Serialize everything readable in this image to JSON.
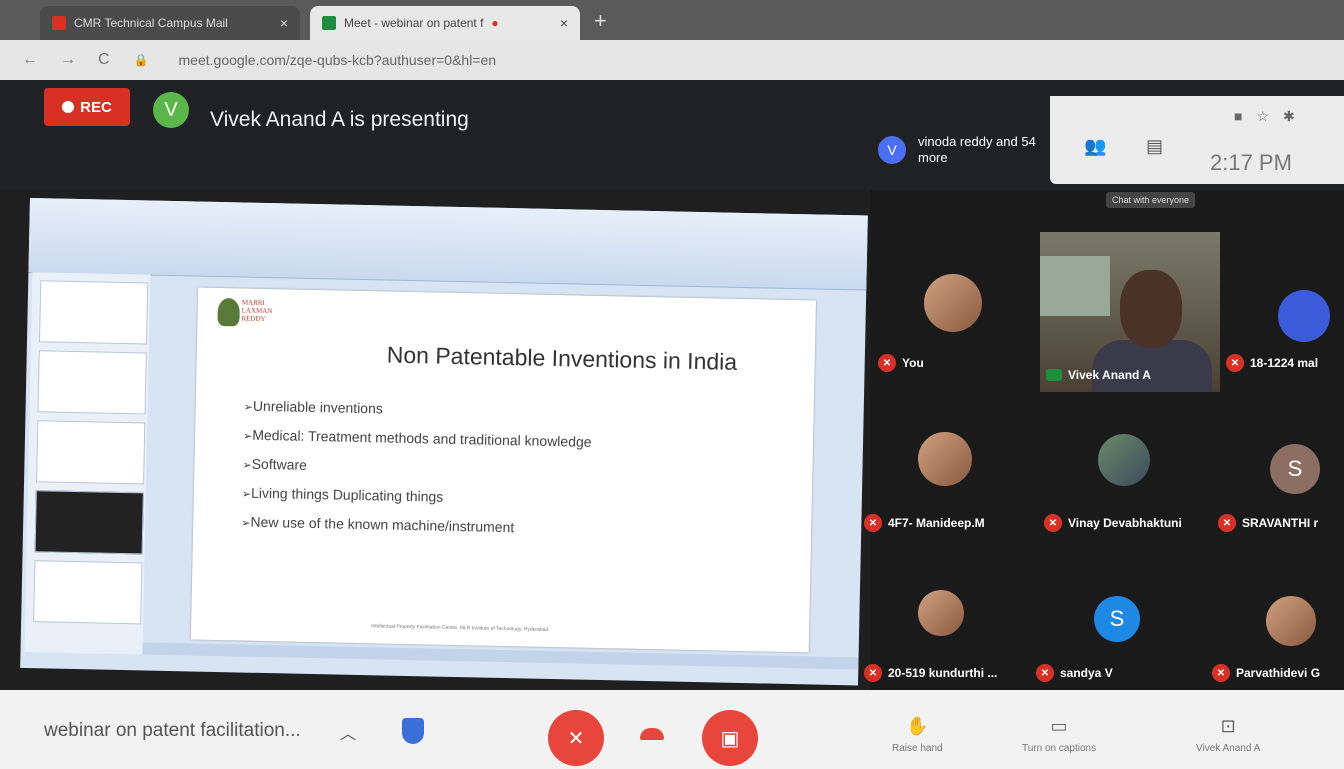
{
  "browser": {
    "tab1_title": "CMR Technical Campus Mail",
    "tab2_title": "Meet - webinar on patent f",
    "new_tab": "+",
    "url": "meet.google.com/zqe-qubs-kcb?authuser=0&hl=en"
  },
  "header": {
    "rec_label": "REC",
    "presenter_initial": "V",
    "presenter_text": "Vivek Anand A is presenting",
    "participants_initial": "V",
    "participants_text": "vinoda reddy and 54 more",
    "time": "2:17 PM",
    "tooltip": "Chat with everyone"
  },
  "slide": {
    "logo_text": "MARRI LAXMAN REDDY",
    "title": "Non Patentable Inventions in India",
    "bullets": [
      "Unreliable inventions",
      "Medical: Treatment methods and traditional knowledge",
      "Software",
      "Living things Duplicating things",
      "New use of the known machine/instrument"
    ],
    "footer": "Intellectual Property Facilitation Centre, MLR Institute of Technology, Hyderabad"
  },
  "participants": [
    {
      "name": "You",
      "type": "photo"
    },
    {
      "name": "Vivek Anand A",
      "type": "video"
    },
    {
      "name": "18-1224 mal",
      "type": "photo"
    },
    {
      "name": "4F7- Manideep.M",
      "type": "photo"
    },
    {
      "name": "Vinay Devabhaktuni",
      "type": "photo"
    },
    {
      "name": "SRAVANTHI r",
      "type": "initial",
      "initial": "S",
      "color": "#8d6e63"
    },
    {
      "name": "20-519 kundurthi ...",
      "type": "photo"
    },
    {
      "name": "sandya V",
      "type": "initial",
      "initial": "S",
      "color": "#1e88e5"
    },
    {
      "name": "Parvathidevi G",
      "type": "photo"
    }
  ],
  "bottom": {
    "meeting_title": "webinar on patent facilitation...",
    "raise_hand": "Raise hand",
    "captions": "Turn on captions",
    "presenting": "Vivek Anand A"
  }
}
